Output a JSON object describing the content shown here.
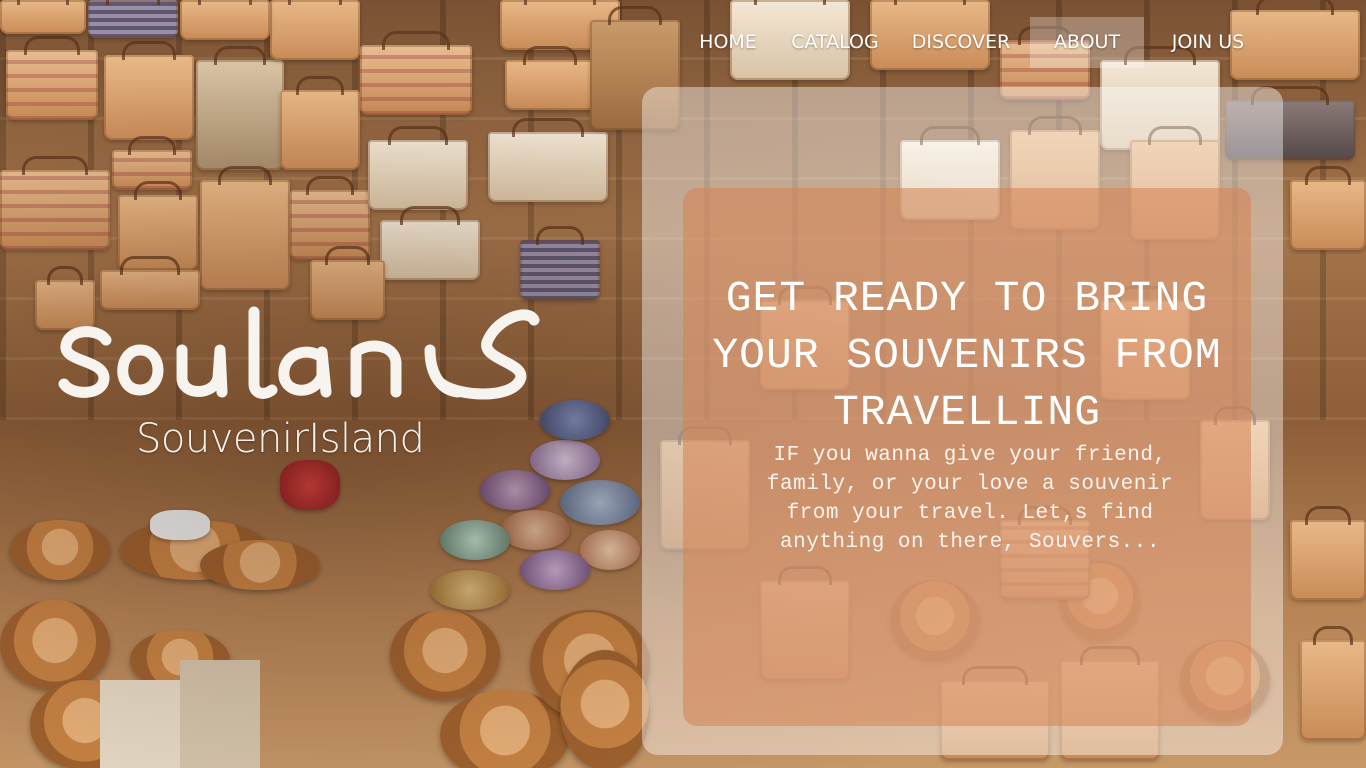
{
  "nav": {
    "items": [
      {
        "label": "HOME"
      },
      {
        "label": "CATALOG"
      },
      {
        "label": "DISCOVER"
      },
      {
        "label": "ABOUT",
        "active": true
      },
      {
        "label": "JOIN US"
      }
    ]
  },
  "brand": {
    "logo_text": "soulans",
    "subtitle": "SouvenirIsland"
  },
  "hero": {
    "headline": "GET READY TO BRING YOUR SOUVENIRS FROM TRAVELLING",
    "intro": "IF you wanna give your friend, family, or your love a souvenir from your travel. Let,s find anything on there, Souvers..."
  },
  "colors": {
    "outer_panel": "rgba(255,255,255,0.42)",
    "inner_panel": "rgba(214,130,80,0.55)",
    "nav_active_bg": "rgba(255,255,255,0.28)",
    "text": "#ffffff"
  }
}
